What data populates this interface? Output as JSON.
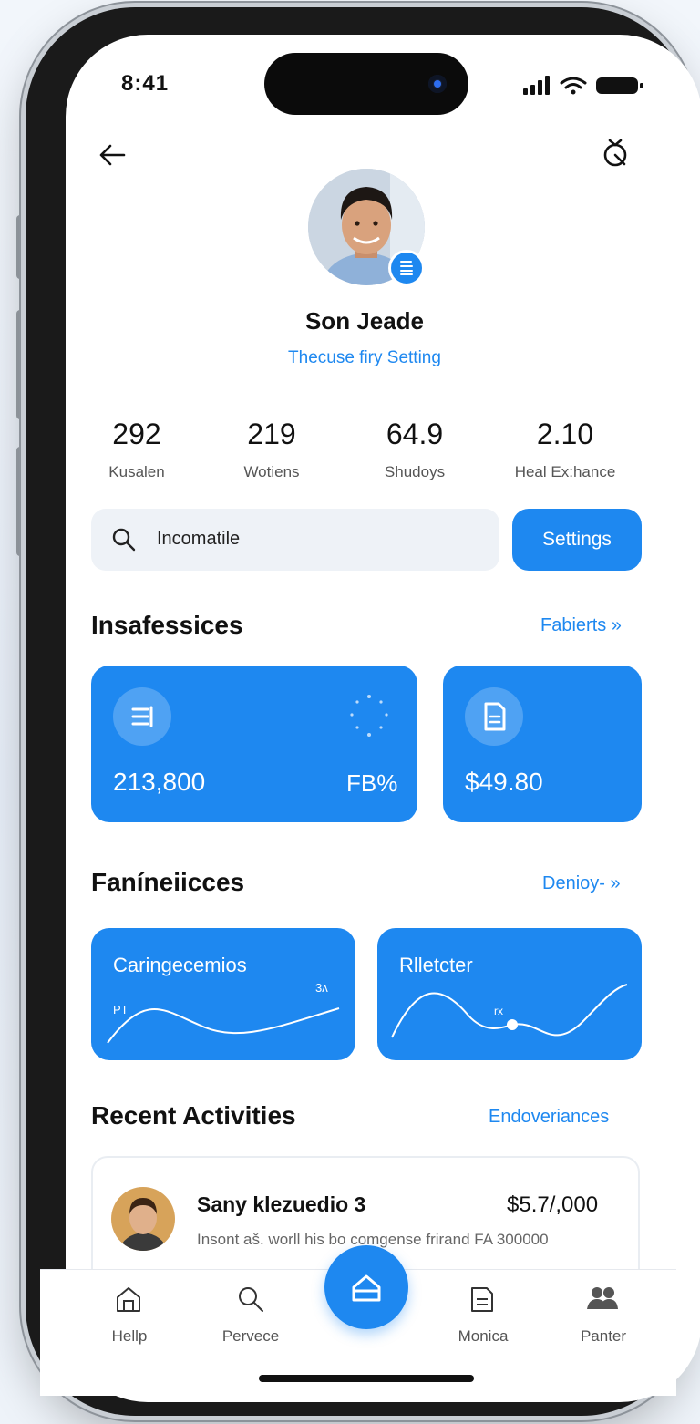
{
  "status": {
    "time": "8:41"
  },
  "profile": {
    "name": "Son Jeade",
    "subtitle": "Thecuse firy Setting"
  },
  "stats": [
    {
      "value": "292",
      "label": "Kusalen"
    },
    {
      "value": "219",
      "label": "Wotiens"
    },
    {
      "value": "64.9",
      "label": "Shudoys"
    },
    {
      "value": "2.10",
      "label": "Heal Ex:hance"
    }
  ],
  "search": {
    "value": "Incomatile"
  },
  "settings_button": "Settings",
  "section1": {
    "title": "Insafessices",
    "link": "Fabierts »",
    "cards": [
      {
        "value": "213,800",
        "badge": "FB%"
      },
      {
        "value": "$49.80"
      }
    ]
  },
  "section2": {
    "title": "Faníneiicces",
    "link": "Denioy- »",
    "cards": [
      {
        "title": "Caringecemios",
        "marker_left": "PT",
        "marker_right": "3ʌ"
      },
      {
        "title": "Rlletcter",
        "marker_point": "rx"
      }
    ]
  },
  "recent": {
    "title": "Recent Activities",
    "link": "Endoveriances",
    "items": [
      {
        "name": "Sany klezuedio 3",
        "amount": "$5.7/,000",
        "description": "Insont aš. worll his bo comgense frirand FA 300000"
      }
    ]
  },
  "tabbar": {
    "items": [
      {
        "label": "Hellp",
        "icon": "home-outline-icon"
      },
      {
        "label": "Pervece",
        "icon": "search-icon"
      },
      {
        "label": "",
        "icon": "home-icon"
      },
      {
        "label": "Monica",
        "icon": "document-icon"
      },
      {
        "label": "Panter",
        "icon": "people-icon"
      }
    ]
  },
  "colors": {
    "accent": "#1e88f0",
    "text": "#111111",
    "muted": "#555555"
  }
}
